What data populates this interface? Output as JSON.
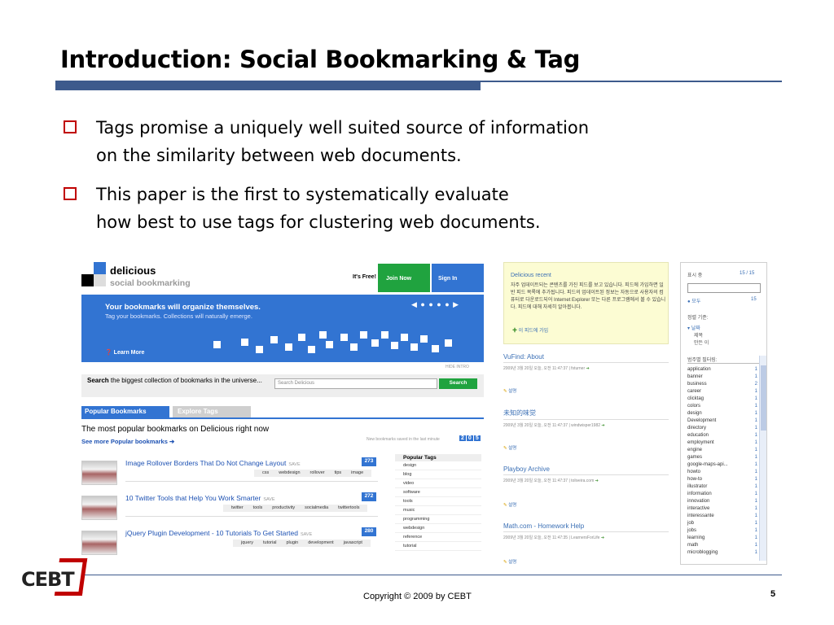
{
  "slide": {
    "title": "Introduction: Social Bookmarking & Tag",
    "bullets": [
      {
        "line1": "Tags promise a uniquely well suited source of information",
        "line2": "on the similarity between web documents."
      },
      {
        "line1": "This paper is the first to systematically evaluate",
        "line2": "how best to use tags for clustering web documents."
      }
    ],
    "copyright": "Copyright © 2009 by CEBT",
    "page_number": "5",
    "logo_text": "CEBT"
  },
  "colors": {
    "accent": "#3d5a8c",
    "bullet": "#c00000",
    "delicious_blue": "#3274d2",
    "delicious_green": "#20a33f"
  },
  "delicious": {
    "brand": "delicious",
    "subtitle": "social bookmarking",
    "its_free": "It's Free!",
    "join_now": "Join Now",
    "sign_in": "Sign In",
    "hero_heading": "Your bookmarks will organize themselves.",
    "hero_sub": "Tag your bookmarks. Collections will naturally emerge.",
    "learn_more": "Learn More",
    "hide_intro": "HIDE INTRO",
    "search_bold": "Search",
    "search_text": "the biggest collection of bookmarks in the universe...",
    "search_placeholder": "Search Delicious",
    "search_button": "Search",
    "tab_popular": "Popular Bookmarks",
    "tab_explore": "Explore Tags",
    "popular_heading": "The most popular bookmarks on Delicious right now",
    "see_more": "See more Popular bookmarks",
    "new_saved": "New bookmarks saved in the last minute",
    "saved_digits": [
      "2",
      "0",
      "5"
    ],
    "bookmarks": [
      {
        "title": "Image Rollover Borders That Do Not Change Layout",
        "save": "SAVE",
        "count": "273",
        "tags": [
          "css",
          "webdesign",
          "rollover",
          "tips",
          "image"
        ]
      },
      {
        "title": "10 Twitter Tools that Help You Work Smarter",
        "save": "SAVE",
        "count": "272",
        "tags": [
          "twitter",
          "tools",
          "productivity",
          "socialmedia",
          "twittertools"
        ]
      },
      {
        "title": "jQuery Plugin Development - 10 Tutorials To Get Started",
        "save": "SAVE",
        "count": "280",
        "tags": [
          "jquery",
          "tutorial",
          "plugin",
          "development",
          "javascript"
        ]
      }
    ],
    "popular_tags_heading": "Popular Tags",
    "popular_tags": [
      "design",
      "blog",
      "video",
      "software",
      "tools",
      "music",
      "programming",
      "webdesign",
      "reference",
      "tutorial"
    ]
  },
  "rss": {
    "recent_title": "Delicious recent",
    "recent_body": "자주 업데이트되는 콘텐츠를 가진 피드를 보고 있습니다. 피드에 가입하면 일반 피드 목록에 추가됩니다. 피드의 업데이트된 정보는 자동으로 사용자의 컴퓨터로 다운로드되어 Internet Explorer 또는 다른 프로그램에서 볼 수 있습니다. 피드에 대해 자세히 알아봅니다.",
    "subscribe": "이 피드에 가입",
    "feeds": [
      {
        "title": "VuFind: About",
        "meta": "2009년 3월 20일 오늘, 오전 11:47:37 | fsturner",
        "detail": "설명"
      },
      {
        "title": "未知的味觉",
        "meta": "2009년 3월 20일 오늘, 오전 11:47:37 | windwisper1982",
        "detail": "설명"
      },
      {
        "title": "Playboy Archive",
        "meta": "2009년 3월 20일 오늘, 오전 11:47:37 | toliveira.com",
        "detail": "설명"
      },
      {
        "title": "Math.com - Homework Help",
        "meta": "2009년 3월 20일 오늘, 오전 11:47:35 | LearnersForLife",
        "detail": "설명"
      }
    ],
    "side": {
      "display_label": "표시 중",
      "display_count": "15 / 15",
      "all_label": "모두",
      "all_count": "15",
      "sort_label": "정렬 기준:",
      "sort_options": [
        "날짜",
        "제목",
        "만든 이"
      ],
      "filter_label": "범주별 필터링:",
      "categories": [
        {
          "name": "application",
          "n": "1"
        },
        {
          "name": "banner",
          "n": "1"
        },
        {
          "name": "business",
          "n": "2"
        },
        {
          "name": "career",
          "n": "1"
        },
        {
          "name": "clicktag",
          "n": "1"
        },
        {
          "name": "colors",
          "n": "1"
        },
        {
          "name": "design",
          "n": "1"
        },
        {
          "name": "Development",
          "n": "1"
        },
        {
          "name": "directory",
          "n": "1"
        },
        {
          "name": "education",
          "n": "1"
        },
        {
          "name": "employment",
          "n": "1"
        },
        {
          "name": "engine",
          "n": "1"
        },
        {
          "name": "games",
          "n": "1"
        },
        {
          "name": "google-maps-api...",
          "n": "1"
        },
        {
          "name": "howto",
          "n": "1"
        },
        {
          "name": "how-to",
          "n": "1"
        },
        {
          "name": "illustrator",
          "n": "1"
        },
        {
          "name": "information",
          "n": "1"
        },
        {
          "name": "innovation",
          "n": "1"
        },
        {
          "name": "interactive",
          "n": "1"
        },
        {
          "name": "interessante",
          "n": "1"
        },
        {
          "name": "job",
          "n": "1"
        },
        {
          "name": "jobs",
          "n": "1"
        },
        {
          "name": "learning",
          "n": "1"
        },
        {
          "name": "math",
          "n": "1"
        },
        {
          "name": "microblogging",
          "n": "1"
        }
      ]
    }
  }
}
